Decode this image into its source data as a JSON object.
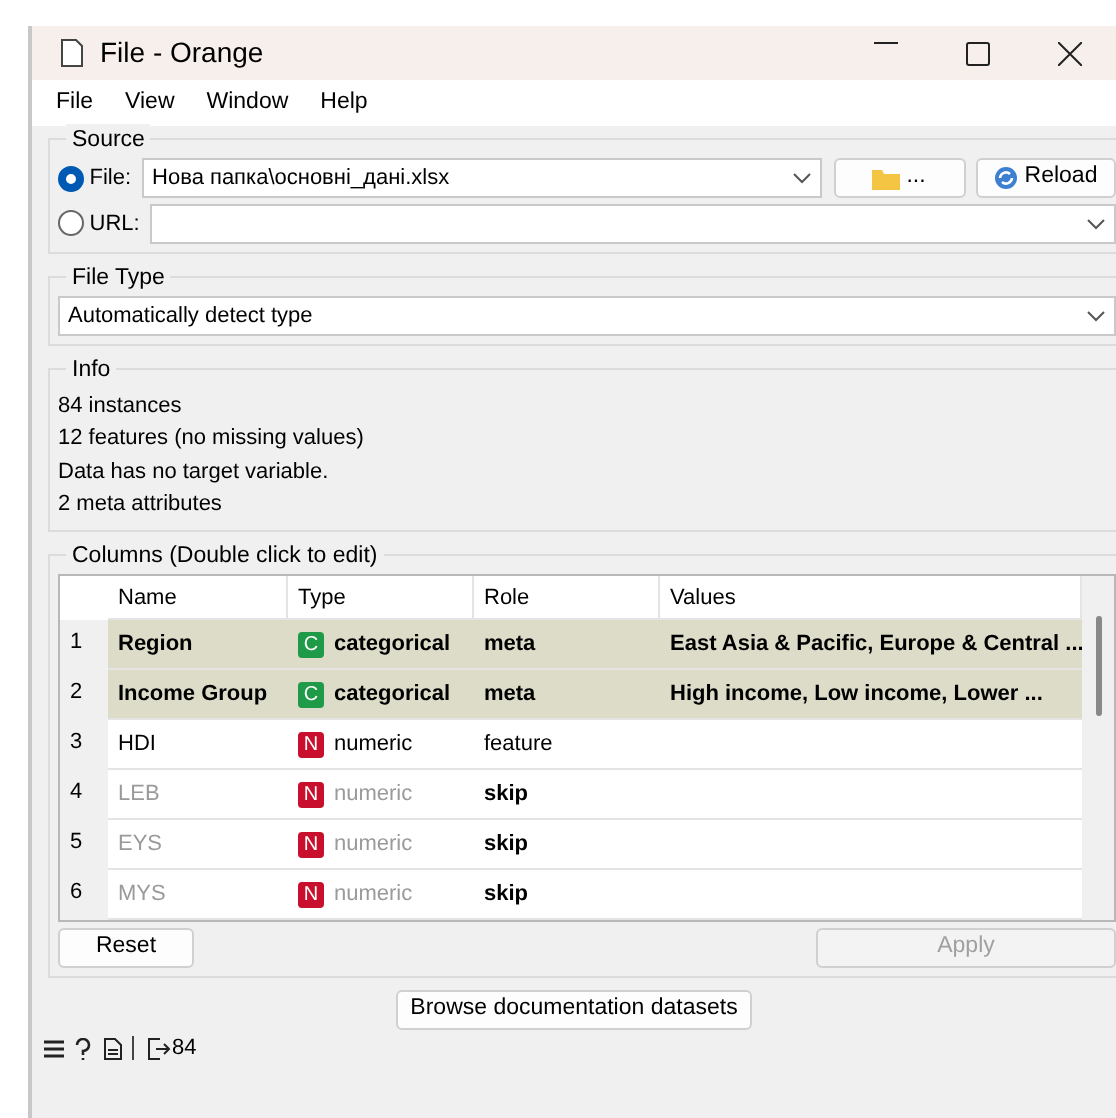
{
  "window": {
    "title": "File - Orange"
  },
  "menu": [
    "File",
    "View",
    "Window",
    "Help"
  ],
  "source": {
    "title": "Source",
    "options": [
      {
        "label": "File:",
        "selected": true,
        "value": "Нова папка\\основні_дані.xlsx",
        "kind": "file"
      },
      {
        "label": "URL:",
        "selected": false,
        "kind": "url"
      }
    ],
    "browse_button": "...",
    "reload_button": "Reload"
  },
  "file_type": {
    "title": "File Type",
    "value": "Automatically detect type"
  },
  "info": {
    "title": "Info",
    "lines": [
      "84 instances",
      "12 features (no missing values)",
      "Data has no target variable.",
      "2 meta attributes"
    ]
  },
  "columns": {
    "title": "Columns (Double click to edit)",
    "headers": [
      "Name",
      "Type",
      "Role",
      "Values"
    ],
    "rows": [
      {
        "index": "1",
        "name": "Region",
        "type": "categorical",
        "kind": "categorical",
        "badge": "C",
        "role": "meta",
        "values": "East Asia & Pacific, Europe & Central ...",
        "selected": true,
        "ignored": false
      },
      {
        "index": "2",
        "name": "Income Group",
        "type": "categorical",
        "kind": "categorical",
        "badge": "C",
        "role": "meta",
        "values": "High income, Low income, Lower ...",
        "selected": true,
        "ignored": false
      },
      {
        "index": "3",
        "name": "HDI",
        "type": "numeric",
        "kind": "numeric",
        "badge": "N",
        "role": "feature",
        "selected": false,
        "ignored": false
      },
      {
        "index": "4",
        "name": "LEB",
        "type": "numeric",
        "kind": "numeric",
        "badge": "N",
        "role": "skip",
        "selected": false,
        "ignored": true
      },
      {
        "index": "5",
        "name": "EYS",
        "type": "numeric",
        "kind": "numeric",
        "badge": "N",
        "role": "skip",
        "selected": false,
        "ignored": true
      },
      {
        "index": "6",
        "name": "MYS",
        "type": "numeric",
        "kind": "numeric",
        "badge": "N",
        "role": "skip",
        "selected": false,
        "ignored": true
      }
    ],
    "reset_button": "Reset",
    "apply_button": {
      "label": "Apply",
      "disabled": true
    }
  },
  "browse_docs_button": "Browse documentation datasets",
  "status_bar": {
    "output_count": "84"
  }
}
